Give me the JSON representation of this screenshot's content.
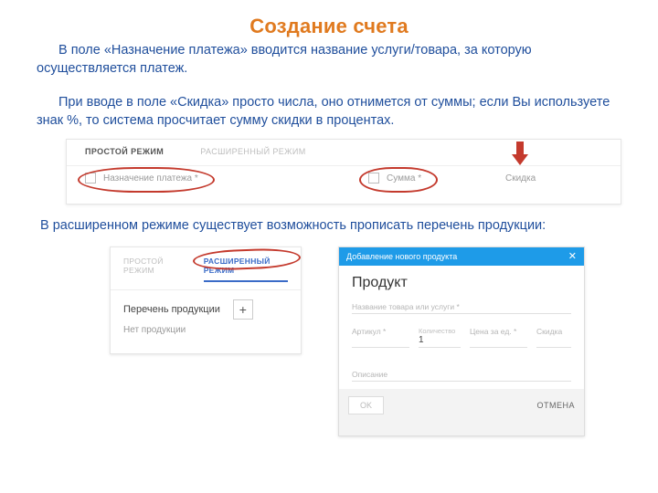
{
  "title": "Создание счета",
  "para1": "В поле «Назначение платежа» вводится название услуги/товара, за которую осуществляется платеж.",
  "para2": "При вводе в поле «Скидка» просто числа, оно отнимется от суммы; если Вы используете знак %, то система просчитает сумму скидки в процентах.",
  "para3": "В расширенном режиме существует возможность прописать перечень продукции:",
  "shot1": {
    "tab_simple": "ПРОСТОЙ РЕЖИМ",
    "tab_extended": "РАСШИРЕННЫЙ РЕЖИМ",
    "field_purpose": "Назначение платежа *",
    "field_sum": "Сумма *",
    "field_discount": "Скидка"
  },
  "shot2": {
    "tab_simple": "ПРОСТОЙ РЕЖИМ",
    "tab_extended": "РАСШИРЕННЫЙ РЕЖИМ",
    "products_label": "Перечень продукции",
    "plus": "+",
    "empty": "Нет продукции"
  },
  "shot3": {
    "bar_title": "Добавление нового продукта",
    "close": "✕",
    "heading": "Продукт",
    "f_name": "Название товара или услуги *",
    "f_article": "Артикул *",
    "f_qty_label": "Количество",
    "f_qty_value": "1",
    "f_price": "Цена за ед. *",
    "f_discount": "Скидка",
    "f_desc": "Описание",
    "btn_ok": "OK",
    "btn_cancel": "ОТМЕНА"
  }
}
